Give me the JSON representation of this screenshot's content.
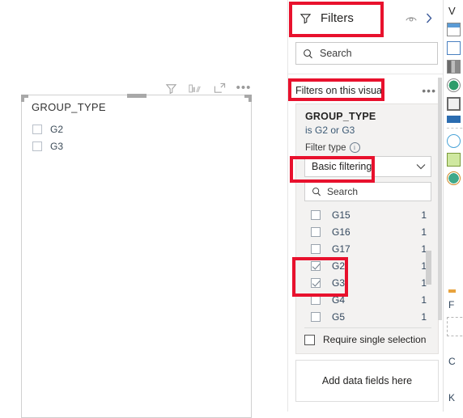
{
  "canvas": {
    "visual_toolbar": [
      {
        "name": "filter-icon",
        "tooltip": "Filters"
      },
      {
        "name": "table-view-icon",
        "tooltip": "Focus table"
      },
      {
        "name": "focus-mode-icon",
        "tooltip": "Focus mode"
      },
      {
        "name": "more-options-icon",
        "tooltip": "More options",
        "glyph": "•••"
      }
    ],
    "slicer": {
      "title": "GROUP_TYPE",
      "items": [
        {
          "label": "G2",
          "checked": false
        },
        {
          "label": "G3",
          "checked": false
        }
      ]
    }
  },
  "filters_pane": {
    "title": "Filters",
    "header_icons": [
      {
        "name": "hide-pane-eye-icon"
      },
      {
        "name": "collapse-chevron-right-icon",
        "glyph": "›"
      }
    ],
    "search": {
      "placeholder": "Search",
      "value": ""
    },
    "section_label": "Filters on this visual",
    "section_more_glyph": "•••",
    "filter_card": {
      "field_name": "GROUP_TYPE",
      "condition": "is G2 or G3",
      "filter_type_label": "Filter type",
      "filter_type_info_glyph": "i",
      "filter_type_value": "Basic filtering",
      "list_search": {
        "placeholder": "Search",
        "value": ""
      },
      "values": [
        {
          "label": "G15",
          "count": "1",
          "checked": false
        },
        {
          "label": "G16",
          "count": "1",
          "checked": false
        },
        {
          "label": "G17",
          "count": "1",
          "checked": false
        },
        {
          "label": "G2",
          "count": "1",
          "checked": true
        },
        {
          "label": "G3",
          "count": "1",
          "checked": true
        },
        {
          "label": "G4",
          "count": "1",
          "checked": false
        },
        {
          "label": "G5",
          "count": "1",
          "checked": false
        }
      ],
      "require_single_selection": {
        "label": "Require single selection",
        "checked": false
      }
    },
    "add_fields_label": "Add data fields here"
  },
  "viz_pane": {
    "title": "V",
    "format_label": "F",
    "column_label": "C",
    "keep_label": "K"
  },
  "annotations": {
    "accent_color": "#e8112d",
    "boxes": [
      {
        "name": "filters-title"
      },
      {
        "name": "filters-on-this-visual"
      },
      {
        "name": "basic-filtering-dropdown"
      },
      {
        "name": "checked-values-g2-g3"
      }
    ]
  }
}
